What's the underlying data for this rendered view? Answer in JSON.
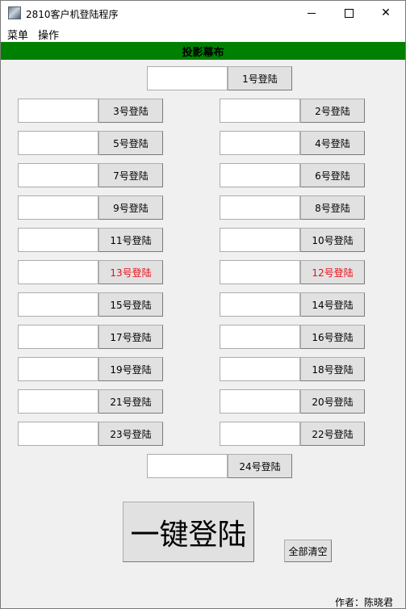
{
  "window": {
    "title": "2810客户机登陆程序",
    "minimize_glyph": "minimize-icon",
    "maximize_glyph": "maximize-icon",
    "close_glyph": "✕"
  },
  "menubar": {
    "items": [
      "菜单",
      "操作"
    ]
  },
  "banner": {
    "label": "投影幕布",
    "color": "#008000"
  },
  "logins": {
    "top": {
      "label": "1号登陆",
      "value": ""
    },
    "left": [
      {
        "label": "3号登陆",
        "value": ""
      },
      {
        "label": "5号登陆",
        "value": ""
      },
      {
        "label": "7号登陆",
        "value": ""
      },
      {
        "label": "9号登陆",
        "value": ""
      },
      {
        "label": "11号登陆",
        "value": ""
      },
      {
        "label": "13号登陆",
        "value": "",
        "highlight": true
      },
      {
        "label": "15号登陆",
        "value": ""
      },
      {
        "label": "17号登陆",
        "value": ""
      },
      {
        "label": "19号登陆",
        "value": ""
      },
      {
        "label": "21号登陆",
        "value": ""
      },
      {
        "label": "23号登陆",
        "value": ""
      }
    ],
    "right": [
      {
        "label": "2号登陆",
        "value": ""
      },
      {
        "label": "4号登陆",
        "value": ""
      },
      {
        "label": "6号登陆",
        "value": ""
      },
      {
        "label": "8号登陆",
        "value": ""
      },
      {
        "label": "10号登陆",
        "value": ""
      },
      {
        "label": "12号登陆",
        "value": "",
        "highlight": true
      },
      {
        "label": "14号登陆",
        "value": ""
      },
      {
        "label": "16号登陆",
        "value": ""
      },
      {
        "label": "18号登陆",
        "value": ""
      },
      {
        "label": "20号登陆",
        "value": ""
      },
      {
        "label": "22号登陆",
        "value": ""
      }
    ],
    "bottom": {
      "label": "24号登陆",
      "value": ""
    },
    "highlight_color": "#e8111a"
  },
  "actions": {
    "one_key_login": "一键登陆",
    "clear_all": "全部清空"
  },
  "footer": {
    "author": "作者：陈晓君"
  }
}
